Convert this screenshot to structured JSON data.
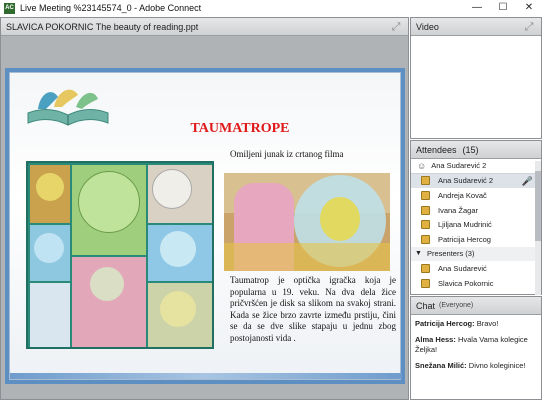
{
  "window": {
    "title": "Live Meeting %23145574_0 - Adobe Connect",
    "app_icon_text": "AC",
    "minimize": "—",
    "maximize": "☐",
    "close": "✕"
  },
  "share_pod": {
    "title": "SLAVICA POKORNIC The beauty of reading.ppt",
    "expand_icon": "⤢"
  },
  "slide": {
    "title": "TAUMATROPE",
    "subtitle": "Omiljeni junak iz crtanog filma",
    "body": "Taumatrop je optička igračka koja je popularna u 19. veku. Na dva dela žice pričvršćen je disk sa slikom na svakoj strani. Kada se žice brzo zavrte između prstiju, čini se da se dve slike stapaju u jednu zbog postojanosti vida ."
  },
  "video_pod": {
    "title": "Video",
    "expand_icon": "⤢"
  },
  "attendees_pod": {
    "title": "Attendees",
    "count": "(15)",
    "me": "Ana Sudarević 2",
    "hosts": [
      "Ana Sudarević 2",
      "Andreja Kovač",
      "Ivana Žagar",
      "Ljiljana Mudrinić",
      "Patricija Hercog"
    ],
    "presenters_group": "Presenters (3)",
    "presenters": [
      "Ana Sudarević",
      "Slavica Pokornic"
    ]
  },
  "chat_pod": {
    "title": "Chat",
    "scope": "(Everyone)",
    "messages": [
      {
        "author": "Patricija Hercog:",
        "text": " Bravo!"
      },
      {
        "author": "Alma Hess:",
        "text": " Hvala Vama kolegice Željka!"
      },
      {
        "author": "Snežana Milić:",
        "text": " Divno koleginice!"
      }
    ]
  },
  "colors": {
    "slide_title": "#e01818",
    "slide_frame": "#5e8fc2",
    "pod_background": "#b0b3b6"
  }
}
